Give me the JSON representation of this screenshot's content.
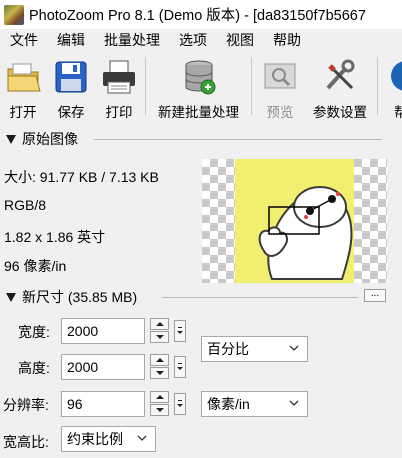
{
  "window": {
    "title": "PhotoZoom Pro 8.1 (Demo 版本) - [da83150f7b5667"
  },
  "menu": [
    "文件",
    "编辑",
    "批量处理",
    "选项",
    "视图",
    "帮助"
  ],
  "toolbar": {
    "open": "打开",
    "save": "保存",
    "print": "打印",
    "new_batch": "新建批量处理",
    "preview": "预览",
    "settings": "参数设置",
    "help": "帮"
  },
  "original": {
    "header": "原始图像",
    "size": "大小: 91.77 KB / 7.13 KB",
    "mode": "RGB/8",
    "dimensions": "1.82 x 1.86 英寸",
    "resolution": "96 像素/in"
  },
  "new_size": {
    "header": "新尺寸 (35.85 MB)",
    "more_button": "...",
    "width_label": "宽度:",
    "width_value": "2000",
    "height_label": "高度:",
    "height_value": "2000",
    "unit_size": "百分比",
    "resolution_label": "分辨率:",
    "resolution_value": "96",
    "unit_resolution": "像素/in",
    "aspect_label": "宽高比:",
    "aspect_value": "约束比例"
  },
  "colors": {
    "accent": "#1e64b4",
    "preview_bg": "#f2ee70"
  }
}
